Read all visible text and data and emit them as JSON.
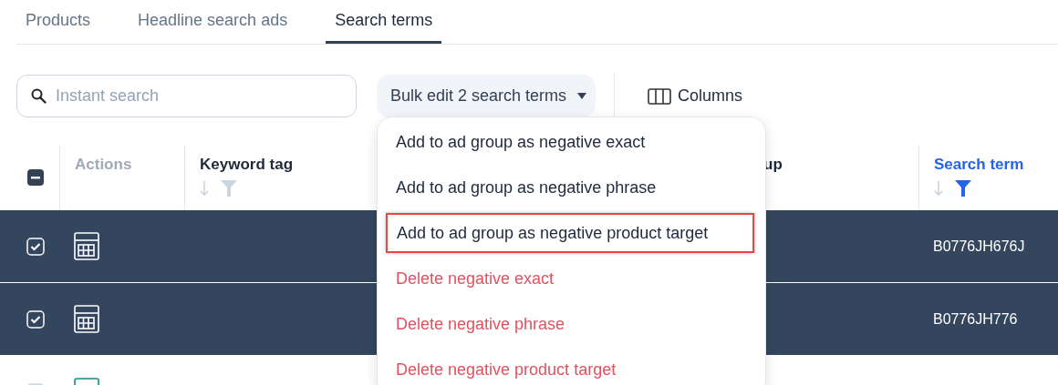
{
  "tabs": [
    {
      "label": "Products",
      "selected": false
    },
    {
      "label": "Headline search ads",
      "selected": false
    },
    {
      "label": "Search terms",
      "selected": true
    }
  ],
  "search": {
    "placeholder": "Instant search"
  },
  "bulk_edit": {
    "label": "Bulk edit 2 search terms",
    "expanded": true
  },
  "columns_button": {
    "label": "Columns"
  },
  "table": {
    "select_all": {
      "indeterminate": true
    },
    "columns": [
      {
        "label": "Actions",
        "active": false
      },
      {
        "label": "Keyword tag",
        "sortable": true,
        "filtered": false,
        "active": false
      },
      {
        "label": "up",
        "active": false
      },
      {
        "label": "Search term",
        "sortable": true,
        "filtered": true,
        "active": true
      }
    ],
    "rows": [
      {
        "selected": true,
        "checked": true,
        "search_term": "B0776JH676J"
      },
      {
        "selected": true,
        "checked": true,
        "search_term": "B0776JH776"
      },
      {
        "selected": false
      }
    ]
  },
  "menu": [
    {
      "label": "Add to ad group as negative exact",
      "kind": "add",
      "highlighted": false
    },
    {
      "label": "Add to ad group as negative phrase",
      "kind": "add",
      "highlighted": false
    },
    {
      "label": "Add to ad group as negative product target",
      "kind": "add",
      "highlighted": true
    },
    {
      "label": "Delete negative exact",
      "kind": "delete",
      "highlighted": false
    },
    {
      "label": "Delete negative phrase",
      "kind": "delete",
      "highlighted": false
    },
    {
      "label": "Delete negative product target",
      "kind": "delete",
      "highlighted": false
    }
  ]
}
